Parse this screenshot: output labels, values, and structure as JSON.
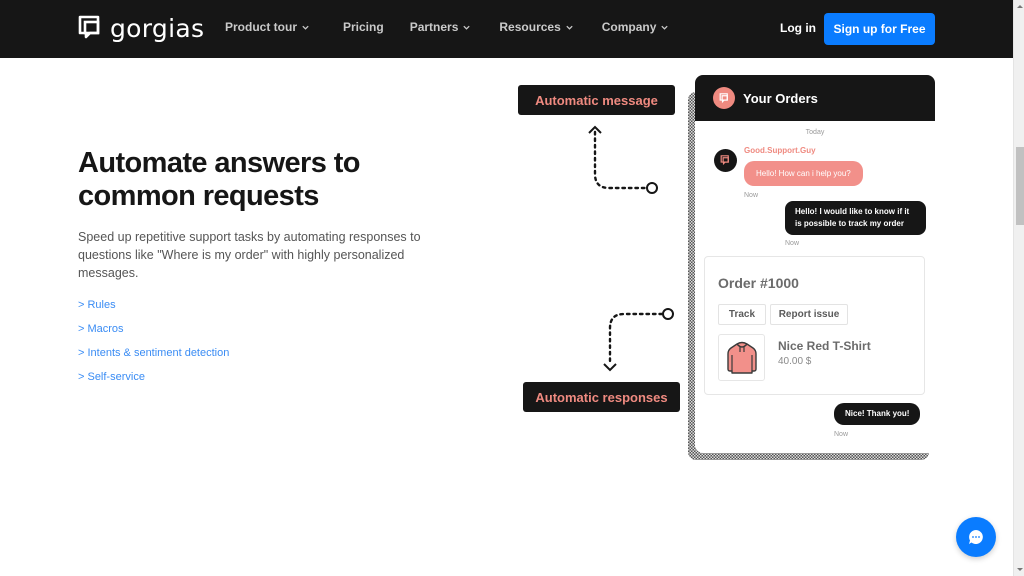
{
  "header": {
    "brand": "gorgias",
    "nav": [
      {
        "label": "Product tour",
        "has_dropdown": true
      },
      {
        "label": "Pricing",
        "has_dropdown": false
      },
      {
        "label": "Partners",
        "has_dropdown": true
      },
      {
        "label": "Resources",
        "has_dropdown": true
      },
      {
        "label": "Company",
        "has_dropdown": true
      }
    ],
    "login_label": "Log in",
    "signup_label": "Sign up for Free"
  },
  "main": {
    "headline": "Automate answers to common requests",
    "description": "Speed up repetitive support tasks by automating responses to questions like \"Where is my order\" with highly personalized messages.",
    "links": [
      {
        "label": "> Rules"
      },
      {
        "label": "> Macros"
      },
      {
        "label": "> Intents & sentiment detection"
      },
      {
        "label": "> Self-service"
      }
    ]
  },
  "illustration": {
    "callout_message": "Automatic message",
    "callout_responses": "Automatic responses",
    "widget": {
      "title": "Your Orders",
      "day_label": "Today",
      "agent_name": "Good.Support.Guy",
      "messages": [
        {
          "from": "agent",
          "text": "Hello! How can i help you?",
          "time": "Now"
        },
        {
          "from": "user",
          "text": "Hello! I would like to know if it is possible to track my order",
          "time": "Now"
        },
        {
          "from": "user",
          "text": "Nice! Thank you!",
          "time": "Now"
        }
      ],
      "order": {
        "title": "Order #1000",
        "actions": [
          "Track",
          "Report issue"
        ],
        "product_name": "Nice Red T-Shirt",
        "product_price": "40.00 $"
      }
    }
  },
  "colors": {
    "brand_dark": "#161616",
    "accent_blue": "#0a7cff",
    "accent_coral": "#ef8a80",
    "link_blue": "#3a8cf4"
  },
  "icons": {
    "logo": "gorgias-logo-icon",
    "chevron": "chevron-down-icon",
    "chat_launcher": "chat-bubble-icon",
    "product": "hoodie-icon"
  }
}
